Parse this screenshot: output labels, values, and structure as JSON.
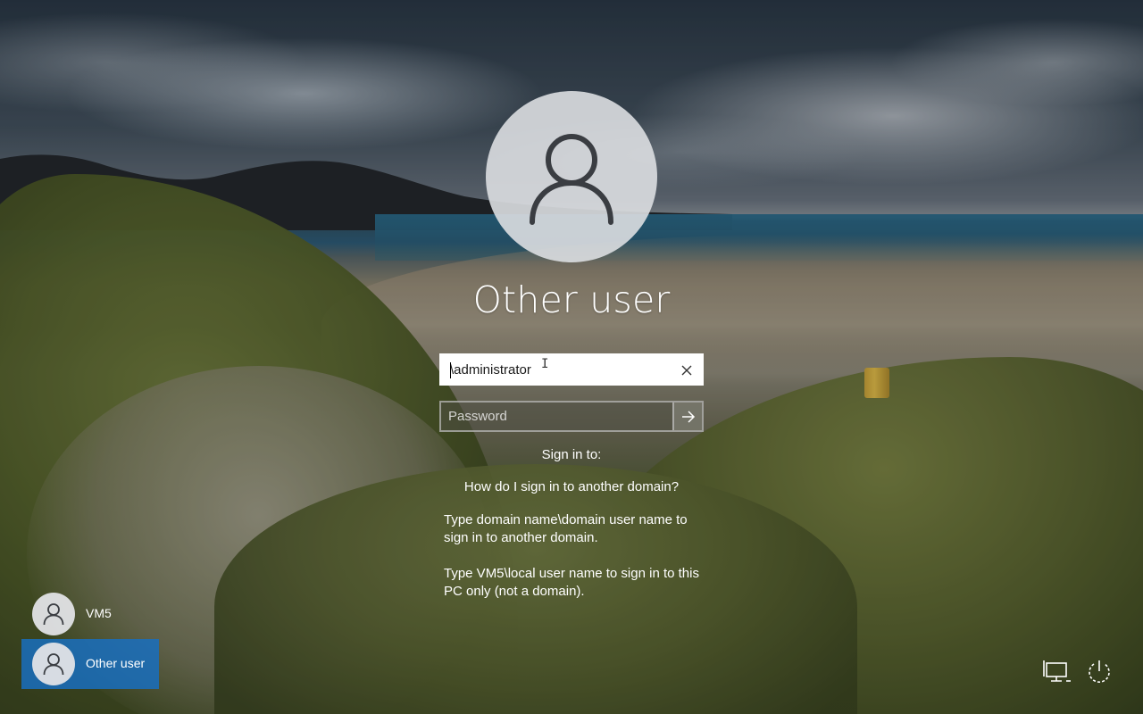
{
  "user": {
    "title": "Other user"
  },
  "username_field": {
    "value": "\\administrator",
    "clear_icon": "close-icon"
  },
  "password_field": {
    "placeholder": "Password",
    "submit_icon": "arrow-right-icon"
  },
  "signin_to": "Sign in to:",
  "help": {
    "link": "How do I sign in to another domain?",
    "line1": "Type domain name\\domain user name to sign in to another domain.",
    "line2": "Type VM5\\local user name to sign in to this PC only (not a domain)."
  },
  "user_list": [
    {
      "label": "VM5",
      "selected": false
    },
    {
      "label": "Other user",
      "selected": true
    }
  ],
  "corner_icons": {
    "network": "network-icon",
    "power": "power-icon"
  },
  "colors": {
    "selected_user": "#196ebe",
    "avatar_bg": "#dcdee1"
  }
}
